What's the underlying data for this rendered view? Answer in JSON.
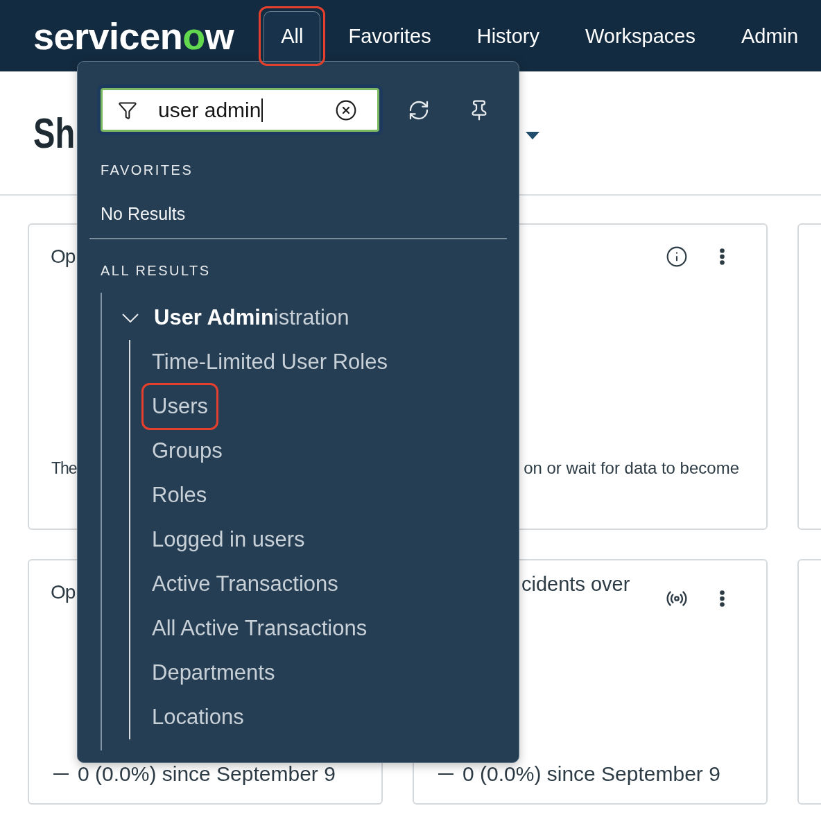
{
  "header": {
    "logo": {
      "parts": [
        {
          "text": "servicen",
          "accent": false
        },
        {
          "text": "o",
          "accent": true
        },
        {
          "text": "w",
          "accent": false
        }
      ]
    },
    "nav": [
      {
        "label": "All",
        "selected": true,
        "highlighted": true
      },
      {
        "label": "Favorites",
        "selected": false,
        "highlighted": false
      },
      {
        "label": "History",
        "selected": false,
        "highlighted": false
      },
      {
        "label": "Workspaces",
        "selected": false,
        "highlighted": false
      },
      {
        "label": "Admin",
        "selected": false,
        "highlighted": false
      }
    ]
  },
  "page": {
    "title": "Sh",
    "cards": [
      {
        "kind": "covered-message",
        "title": "Op",
        "message": "The"
      },
      {
        "kind": "message",
        "message": "on or wait for data to become"
      },
      {
        "kind": "edge"
      },
      {
        "kind": "covered-score",
        "title": "Op",
        "delta": "0 (0.0%) since September 9"
      },
      {
        "kind": "score",
        "title": "cidents over",
        "delta": "0 (0.0%) since September 9"
      },
      {
        "kind": "edge"
      }
    ]
  },
  "menu": {
    "search": {
      "value": "user admin"
    },
    "favorites": {
      "heading": "FAVORITES",
      "empty_text": "No Results"
    },
    "results": {
      "heading": "ALL RESULTS",
      "groups": [
        {
          "label": "**User Admin**istration",
          "expanded": true,
          "children": [
            {
              "label": "Time-Limited User Roles",
              "highlighted": false
            },
            {
              "label": "Users",
              "highlighted": true
            },
            {
              "label": "Groups",
              "highlighted": false
            },
            {
              "label": "Roles",
              "highlighted": false
            },
            {
              "label": "Logged in users",
              "highlighted": false
            },
            {
              "label": "Active Transactions",
              "highlighted": false
            },
            {
              "label": "All Active Transactions",
              "highlighted": false
            },
            {
              "label": "Departments",
              "highlighted": false
            },
            {
              "label": "Locations",
              "highlighted": false
            }
          ]
        }
      ]
    }
  }
}
